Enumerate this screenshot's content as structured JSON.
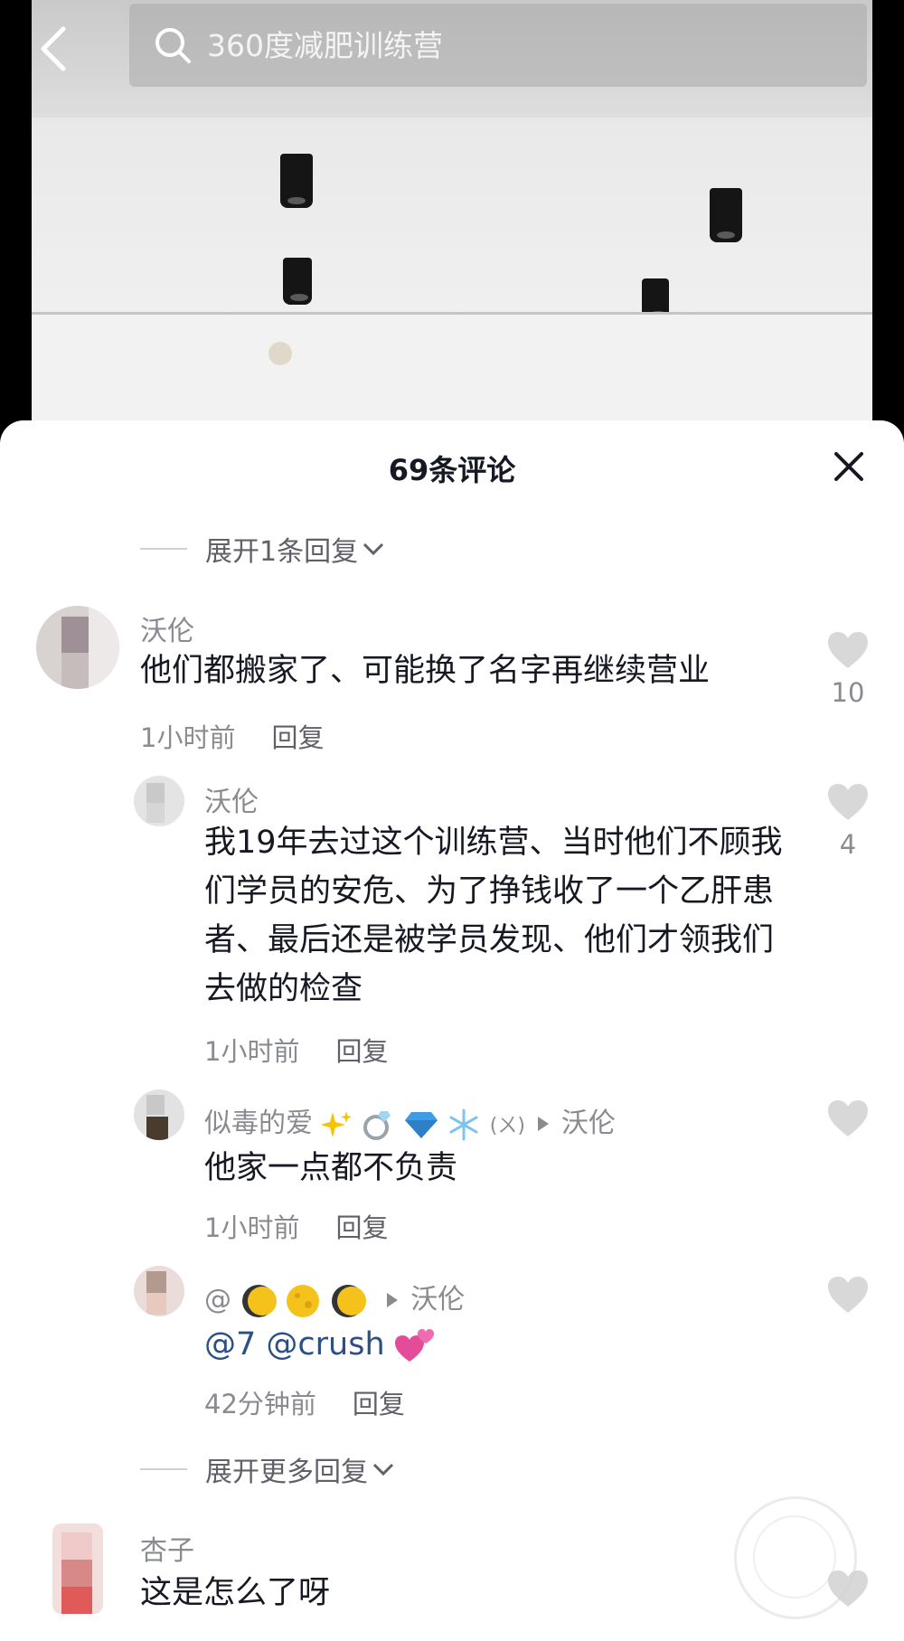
{
  "search": {
    "placeholder": "360度减肥训练营"
  },
  "sheet": {
    "title": "69条评论"
  },
  "expand_top": {
    "label": "展开1条回复"
  },
  "expand_more": {
    "label": "展开更多回复"
  },
  "comments": [
    {
      "name": "沃伦",
      "text": "他们都搬家了、可能换了名字再继续营业",
      "time": "1小时前",
      "reply": "回复",
      "likes": "10"
    },
    {
      "name": "沃伦",
      "text": "我19年去过这个训练营、当时他们不顾我们学员的安危、为了挣钱收了一个乙肝患者、最后还是被学员发现、他们才领我们去做的检查",
      "time": "1小时前",
      "reply": "回复",
      "likes": "4"
    },
    {
      "name": "似毒的爱",
      "name_suffix": "(ㄨ)",
      "reply_to": "沃伦",
      "text": "他家一点都不负责",
      "time": "1小时前",
      "reply": "回复",
      "likes": ""
    },
    {
      "name": "@",
      "reply_to": "沃伦",
      "text": "@7 @crush",
      "time": "42分钟前",
      "reply": "回复",
      "likes": ""
    },
    {
      "name": "杏子",
      "text": "这是怎么了呀",
      "time": "",
      "reply": "",
      "likes": ""
    }
  ],
  "icons": [
    "back-icon",
    "search-icon",
    "close-icon",
    "chevron-down-icon",
    "heart-icon",
    "sparkles-icon",
    "ring-icon",
    "gem-icon",
    "snowflake-icon",
    "moon-icon",
    "two-hearts-icon"
  ],
  "colors": {
    "sheet_bg": "#ffffff",
    "text": "#161823",
    "muted": "#8a8b91",
    "mention": "#2b4f86",
    "heart": "#d8d8d8"
  }
}
